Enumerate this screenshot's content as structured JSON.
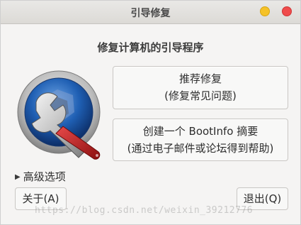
{
  "window": {
    "title": "引导修复"
  },
  "main": {
    "heading": "修复计算机的引导程序",
    "recommended_repair": {
      "line1": "推荐修复",
      "line2": "(修复常见问题)"
    },
    "bootinfo": {
      "line1": "创建一个 BootInfo 摘要",
      "line2": "(通过电子邮件或论坛得到帮助)"
    },
    "advanced_label": "高级选项"
  },
  "footer": {
    "about_label": "关于(A)",
    "quit_label": "退出(Q)"
  },
  "watermark": {
    "text": "https://blog.csdn.net/weixin_39212776"
  },
  "colors": {
    "minimize": "#f5c228",
    "close": "#ef4c4c"
  },
  "icons": {
    "logo": "boot-repair-wrench-icon"
  }
}
